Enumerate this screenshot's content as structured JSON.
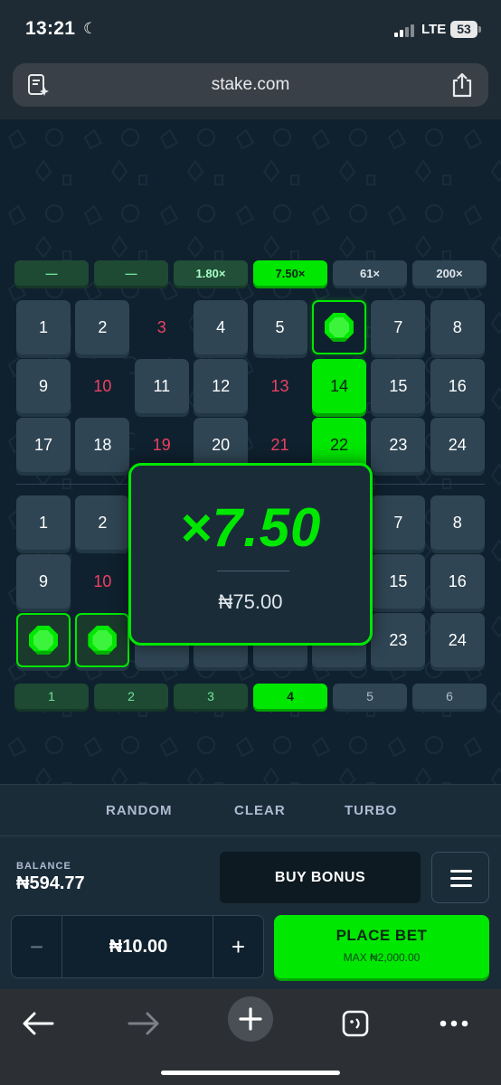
{
  "status": {
    "time": "13:21",
    "network": "LTE",
    "battery": "53"
  },
  "browser": {
    "url": "stake.com"
  },
  "multipliers": [
    "—",
    "—",
    "1.80×",
    "7.50×",
    "61×",
    "200×"
  ],
  "grid1": {
    "rows": [
      [
        "1",
        "2",
        "3",
        "4",
        "5",
        "",
        "7",
        "8"
      ],
      [
        "9",
        "10",
        "11",
        "12",
        "13",
        "14",
        "15",
        "16"
      ],
      [
        "17",
        "18",
        "19",
        "20",
        "21",
        "22",
        "23",
        "24"
      ]
    ]
  },
  "grid2": {
    "rows": [
      [
        "1",
        "2",
        "",
        "",
        "",
        "",
        "7",
        "8"
      ],
      [
        "9",
        "10",
        "",
        "",
        "",
        "15",
        "16"
      ],
      [
        "",
        "",
        "",
        "",
        "",
        "",
        "23",
        "24"
      ]
    ]
  },
  "counts": [
    "1",
    "2",
    "3",
    "4",
    "5",
    "6"
  ],
  "win": {
    "multiplier": "×7.50",
    "amount": "₦75.00"
  },
  "controls": {
    "tabs": [
      "RANDOM",
      "CLEAR",
      "TURBO"
    ],
    "balance_label": "BALANCE",
    "balance_value": "₦594.77",
    "buy_bonus": "BUY BONUS",
    "bet_amount": "₦10.00",
    "minus": "−",
    "plus": "+",
    "place_bet": "PLACE BET",
    "max_bet": "MAX ₦2,000.00"
  },
  "colors": {
    "accent": "#00e701",
    "miss": "#ed4163",
    "tile": "#2f4553",
    "bg": "#0f212e"
  }
}
